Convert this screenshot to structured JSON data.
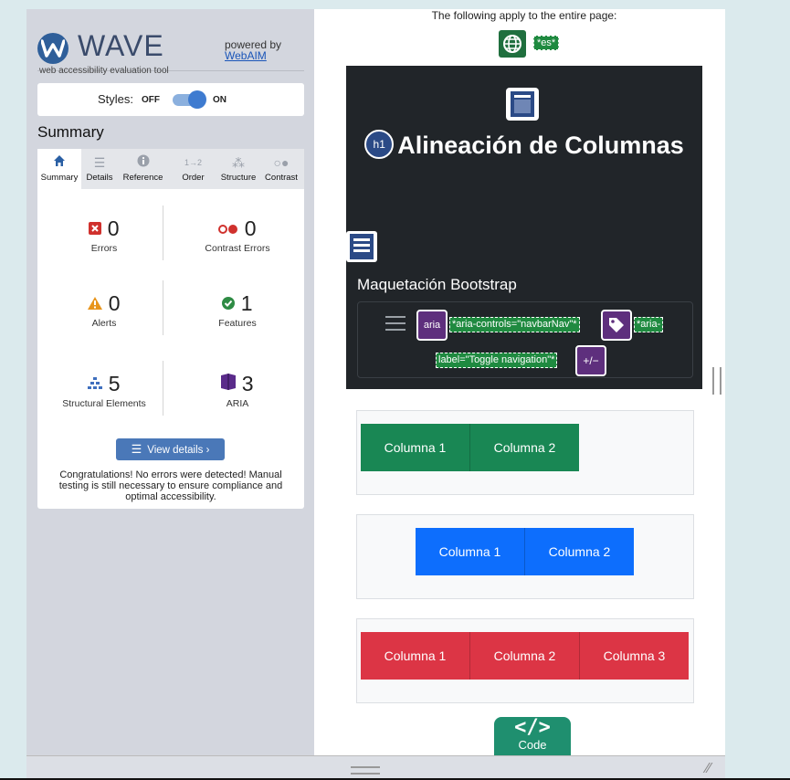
{
  "wave": {
    "logo_text": "WAVE",
    "tagline": "web accessibility evaluation tool",
    "powered_by": "powered by",
    "webaim": "WebAIM"
  },
  "styles": {
    "label": "Styles:",
    "off": "OFF",
    "on": "ON",
    "state": "on"
  },
  "summary_title": "Summary",
  "tabs": [
    {
      "label": "Summary",
      "icon": "home-icon",
      "active": true
    },
    {
      "label": "Details",
      "icon": "list-icon"
    },
    {
      "label": "Reference",
      "icon": "info-icon"
    },
    {
      "label": "Order",
      "icon": "order-icon"
    },
    {
      "label": "Structure",
      "icon": "structure-icon"
    },
    {
      "label": "Contrast",
      "icon": "contrast-icon"
    }
  ],
  "stats": {
    "errors": {
      "value": "0",
      "label": "Errors"
    },
    "contrast_errors": {
      "value": "0",
      "label": "Contrast Errors"
    },
    "alerts": {
      "value": "0",
      "label": "Alerts"
    },
    "features": {
      "value": "1",
      "label": "Features"
    },
    "structural": {
      "value": "5",
      "label": "Structural Elements"
    },
    "aria": {
      "value": "3",
      "label": "ARIA"
    }
  },
  "view_details": "View details ›",
  "congrats": "Congratulations! No errors were detected! Manual testing is still necessary to ensure compliance and optimal accessibility.",
  "page": {
    "note": "The following apply to the entire page:",
    "lang_tag": "*es*",
    "heading_badge": "h1",
    "heading": "Alineación de Columnas",
    "brand": "Maquetación Bootstrap",
    "aria_icon": "aria",
    "aria_controls": "*aria-controls=\"navbarNav\"*",
    "aria_label_1": "*aria-",
    "aria_label_2": "label=\"Toggle navigation\"*",
    "expand_icon": "+/−",
    "rows": [
      {
        "color": "#198754",
        "cols": [
          "Columna 1",
          "Columna 2"
        ]
      },
      {
        "color": "#0d6efd",
        "cols": [
          "Columna 1",
          "Columna 2"
        ]
      },
      {
        "color": "#dc3545",
        "cols": [
          "Columna 1",
          "Columna 2",
          "Columna 3"
        ]
      }
    ],
    "code_badge": "Code"
  }
}
